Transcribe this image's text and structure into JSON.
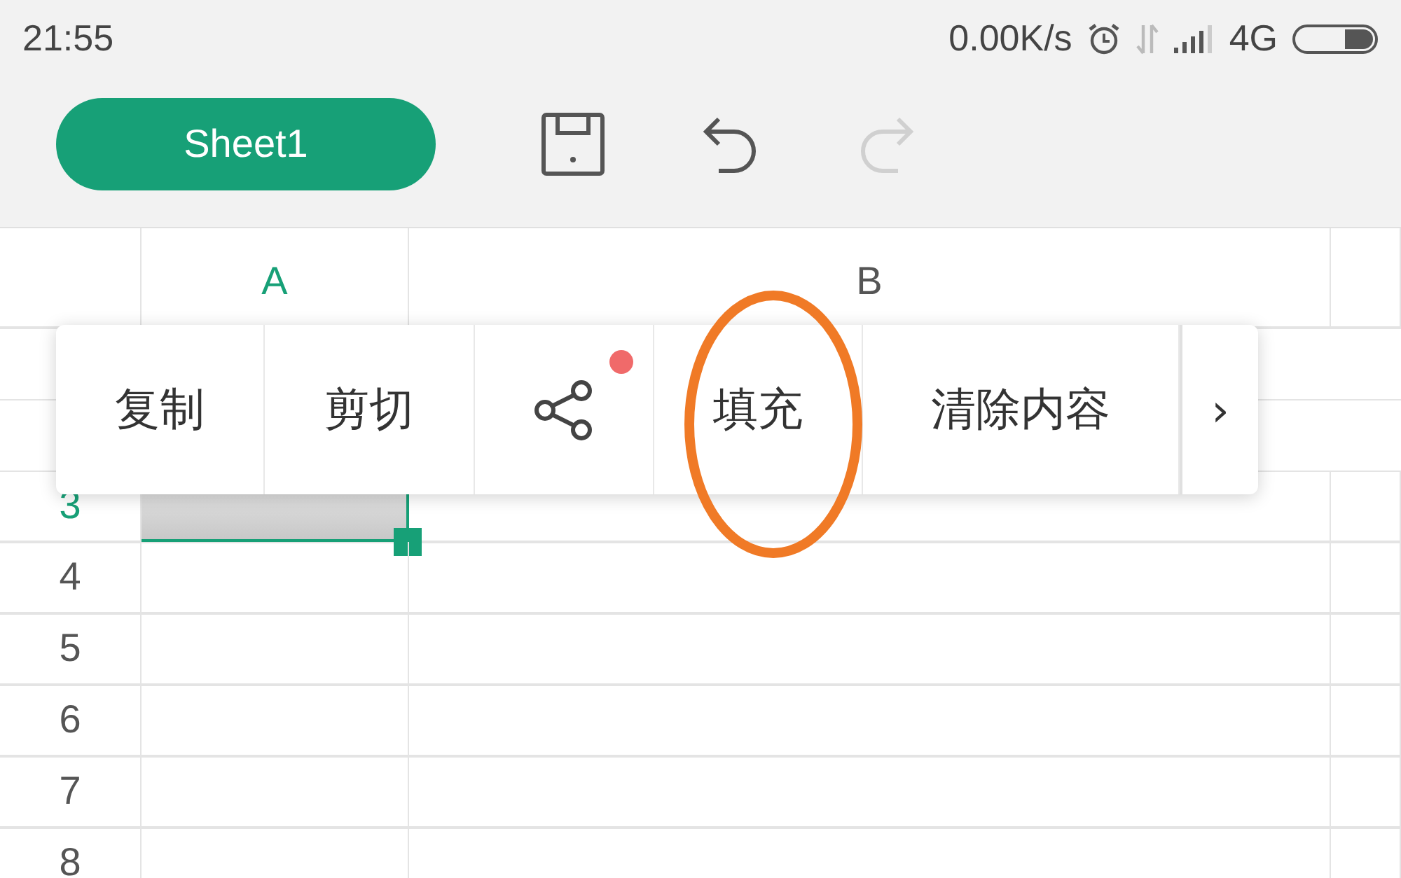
{
  "status_bar": {
    "time": "21:55",
    "net_speed": "0.00K/s",
    "network": "4G"
  },
  "toolbar": {
    "sheet_tab": {
      "label": "Sheet1",
      "selected": true
    },
    "buttons": [
      {
        "kind": "save",
        "disabled": false
      },
      {
        "kind": "undo",
        "disabled": false
      },
      {
        "kind": "redo",
        "disabled": true
      }
    ]
  },
  "sheet": {
    "columns": [
      {
        "label": "A",
        "selected": true
      },
      {
        "label": "B",
        "selected": false
      }
    ],
    "rows": [
      {
        "label": "3",
        "selected": true
      },
      {
        "label": "4",
        "selected": false
      },
      {
        "label": "5",
        "selected": false
      },
      {
        "label": "6",
        "selected": false
      },
      {
        "label": "7",
        "selected": false
      },
      {
        "label": "8",
        "selected": false
      }
    ]
  },
  "context_menu": {
    "items": [
      {
        "kind": "text",
        "label": "复制"
      },
      {
        "kind": "text",
        "label": "剪切"
      },
      {
        "kind": "share",
        "badge": true
      },
      {
        "kind": "text",
        "label": "填充"
      },
      {
        "kind": "text",
        "label": "清除内容"
      },
      {
        "kind": "more",
        "label": "›"
      }
    ]
  }
}
